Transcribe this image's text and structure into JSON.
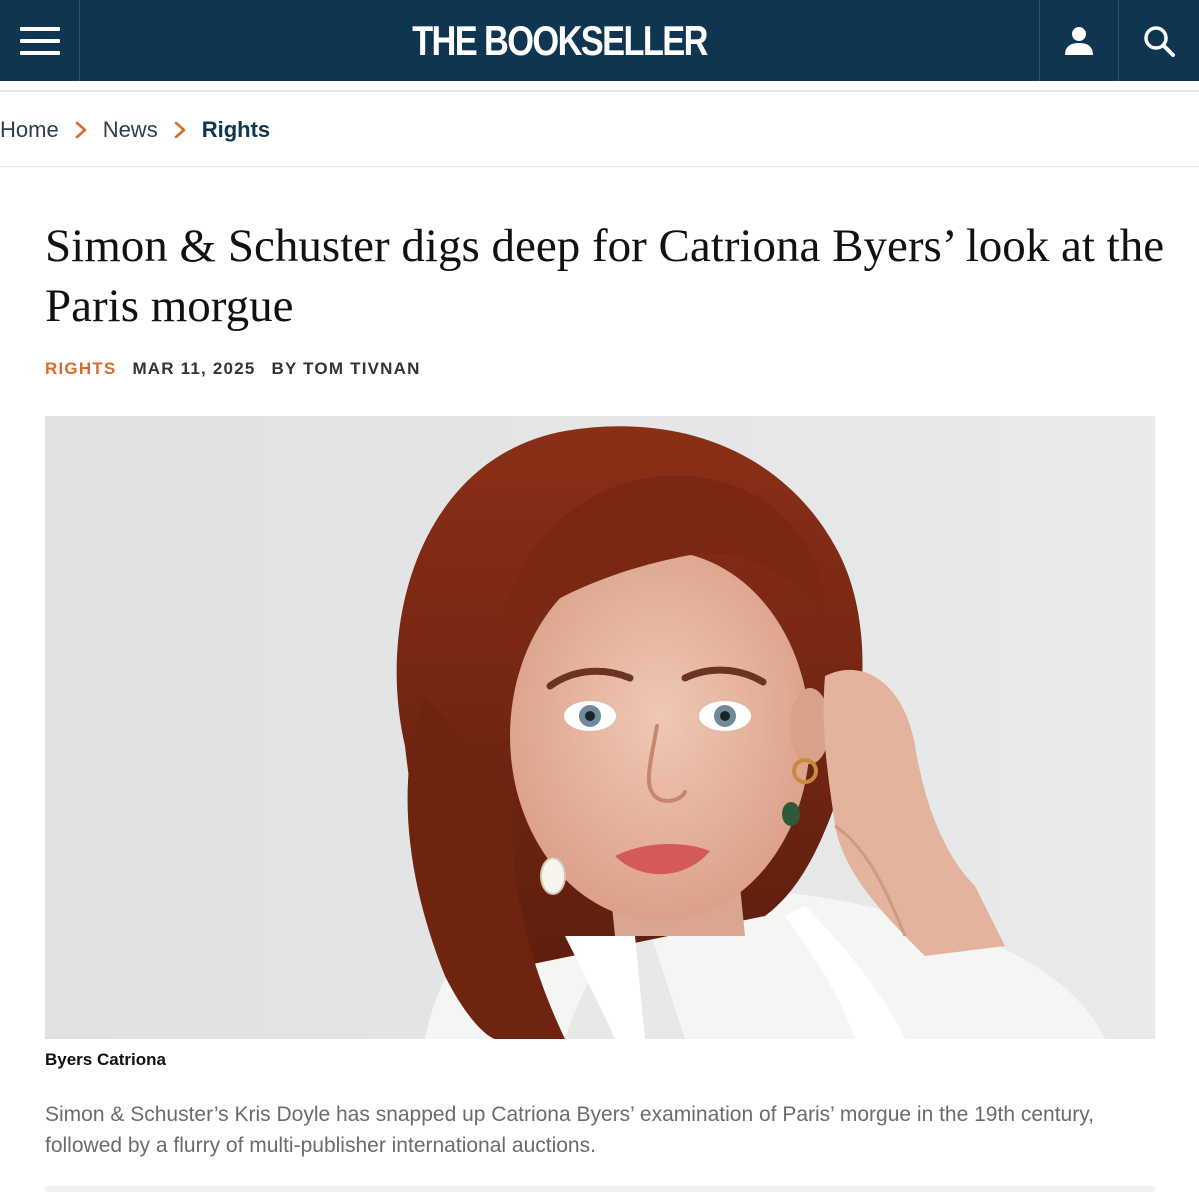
{
  "header": {
    "logo_text": "THE BOOKSELLER",
    "menu_icon": "hamburger-menu-icon",
    "user_icon": "user-icon",
    "search_icon": "search-icon",
    "bg_color": "#0f3550"
  },
  "breadcrumb": {
    "items": [
      "Home",
      "News",
      "Rights"
    ],
    "separator_icon": "chevron-right-icon",
    "separator_color": "#d96a2c"
  },
  "article": {
    "title": "Simon & Schuster digs deep for Catriona Byers’ look at the Paris morgue",
    "category": "RIGHTS",
    "date": "MAR 11, 2025",
    "byline": "BY TOM TIVNAN",
    "category_color": "#d96a2c",
    "image_caption": "Byers Catriona",
    "standfirst": "Simon & Schuster’s Kris Doyle has snapped up Catriona Byers’ examination of Paris’ morgue in the 19th century, followed by a flurry of multi-publisher international auctions."
  }
}
